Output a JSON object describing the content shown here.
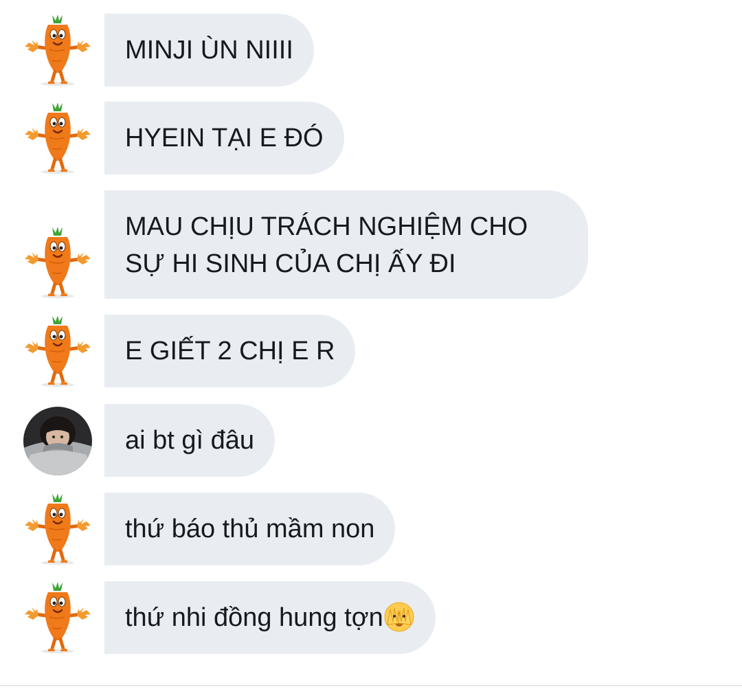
{
  "messages": [
    {
      "sender": "carrot",
      "text": "MINJI ÙN NIIII"
    },
    {
      "sender": "carrot",
      "text": "HYEIN TẠI E ĐÓ"
    },
    {
      "sender": "carrot",
      "lines": [
        "MAU CHỊU TRÁCH NGHIỆM CHO",
        "SỰ HI SINH CỦA CHỊ ẤY ĐI"
      ]
    },
    {
      "sender": "carrot",
      "text": "E GIẾT 2 CHỊ E R"
    },
    {
      "sender": "photo",
      "text": "ai bt gì đâu"
    },
    {
      "sender": "carrot",
      "text": "thứ báo thủ mầm non"
    },
    {
      "sender": "carrot",
      "text": "thứ nhi đồng hung tợn",
      "emoji": "face-peeking-through-hands-icon"
    }
  ],
  "colors": {
    "bubble": "#e9edf2",
    "text": "#16191d",
    "carrot": "#f07a1a",
    "leaf": "#3fa535"
  }
}
